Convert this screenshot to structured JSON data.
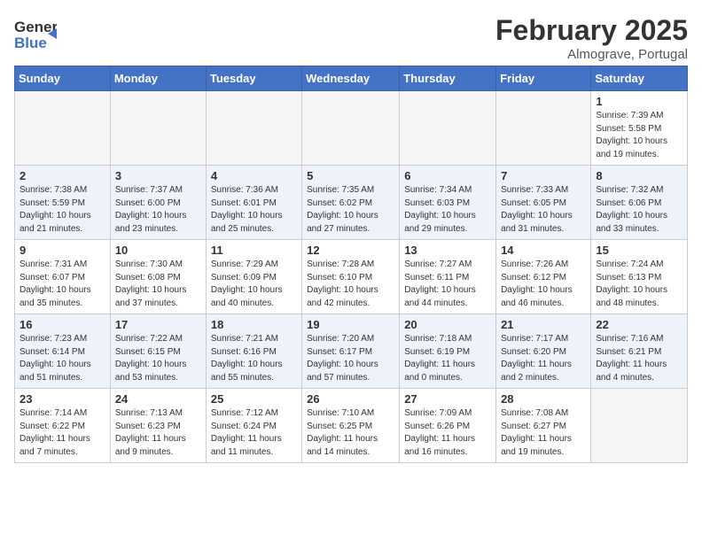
{
  "header": {
    "logo_general": "General",
    "logo_blue": "Blue",
    "title": "February 2025",
    "subtitle": "Almograve, Portugal"
  },
  "weekdays": [
    "Sunday",
    "Monday",
    "Tuesday",
    "Wednesday",
    "Thursday",
    "Friday",
    "Saturday"
  ],
  "weeks": [
    [
      {
        "day": "",
        "info": ""
      },
      {
        "day": "",
        "info": ""
      },
      {
        "day": "",
        "info": ""
      },
      {
        "day": "",
        "info": ""
      },
      {
        "day": "",
        "info": ""
      },
      {
        "day": "",
        "info": ""
      },
      {
        "day": "1",
        "info": "Sunrise: 7:39 AM\nSunset: 5:58 PM\nDaylight: 10 hours and 19 minutes."
      }
    ],
    [
      {
        "day": "2",
        "info": "Sunrise: 7:38 AM\nSunset: 5:59 PM\nDaylight: 10 hours and 21 minutes."
      },
      {
        "day": "3",
        "info": "Sunrise: 7:37 AM\nSunset: 6:00 PM\nDaylight: 10 hours and 23 minutes."
      },
      {
        "day": "4",
        "info": "Sunrise: 7:36 AM\nSunset: 6:01 PM\nDaylight: 10 hours and 25 minutes."
      },
      {
        "day": "5",
        "info": "Sunrise: 7:35 AM\nSunset: 6:02 PM\nDaylight: 10 hours and 27 minutes."
      },
      {
        "day": "6",
        "info": "Sunrise: 7:34 AM\nSunset: 6:03 PM\nDaylight: 10 hours and 29 minutes."
      },
      {
        "day": "7",
        "info": "Sunrise: 7:33 AM\nSunset: 6:05 PM\nDaylight: 10 hours and 31 minutes."
      },
      {
        "day": "8",
        "info": "Sunrise: 7:32 AM\nSunset: 6:06 PM\nDaylight: 10 hours and 33 minutes."
      }
    ],
    [
      {
        "day": "9",
        "info": "Sunrise: 7:31 AM\nSunset: 6:07 PM\nDaylight: 10 hours and 35 minutes."
      },
      {
        "day": "10",
        "info": "Sunrise: 7:30 AM\nSunset: 6:08 PM\nDaylight: 10 hours and 37 minutes."
      },
      {
        "day": "11",
        "info": "Sunrise: 7:29 AM\nSunset: 6:09 PM\nDaylight: 10 hours and 40 minutes."
      },
      {
        "day": "12",
        "info": "Sunrise: 7:28 AM\nSunset: 6:10 PM\nDaylight: 10 hours and 42 minutes."
      },
      {
        "day": "13",
        "info": "Sunrise: 7:27 AM\nSunset: 6:11 PM\nDaylight: 10 hours and 44 minutes."
      },
      {
        "day": "14",
        "info": "Sunrise: 7:26 AM\nSunset: 6:12 PM\nDaylight: 10 hours and 46 minutes."
      },
      {
        "day": "15",
        "info": "Sunrise: 7:24 AM\nSunset: 6:13 PM\nDaylight: 10 hours and 48 minutes."
      }
    ],
    [
      {
        "day": "16",
        "info": "Sunrise: 7:23 AM\nSunset: 6:14 PM\nDaylight: 10 hours and 51 minutes."
      },
      {
        "day": "17",
        "info": "Sunrise: 7:22 AM\nSunset: 6:15 PM\nDaylight: 10 hours and 53 minutes."
      },
      {
        "day": "18",
        "info": "Sunrise: 7:21 AM\nSunset: 6:16 PM\nDaylight: 10 hours and 55 minutes."
      },
      {
        "day": "19",
        "info": "Sunrise: 7:20 AM\nSunset: 6:17 PM\nDaylight: 10 hours and 57 minutes."
      },
      {
        "day": "20",
        "info": "Sunrise: 7:18 AM\nSunset: 6:19 PM\nDaylight: 11 hours and 0 minutes."
      },
      {
        "day": "21",
        "info": "Sunrise: 7:17 AM\nSunset: 6:20 PM\nDaylight: 11 hours and 2 minutes."
      },
      {
        "day": "22",
        "info": "Sunrise: 7:16 AM\nSunset: 6:21 PM\nDaylight: 11 hours and 4 minutes."
      }
    ],
    [
      {
        "day": "23",
        "info": "Sunrise: 7:14 AM\nSunset: 6:22 PM\nDaylight: 11 hours and 7 minutes."
      },
      {
        "day": "24",
        "info": "Sunrise: 7:13 AM\nSunset: 6:23 PM\nDaylight: 11 hours and 9 minutes."
      },
      {
        "day": "25",
        "info": "Sunrise: 7:12 AM\nSunset: 6:24 PM\nDaylight: 11 hours and 11 minutes."
      },
      {
        "day": "26",
        "info": "Sunrise: 7:10 AM\nSunset: 6:25 PM\nDaylight: 11 hours and 14 minutes."
      },
      {
        "day": "27",
        "info": "Sunrise: 7:09 AM\nSunset: 6:26 PM\nDaylight: 11 hours and 16 minutes."
      },
      {
        "day": "28",
        "info": "Sunrise: 7:08 AM\nSunset: 6:27 PM\nDaylight: 11 hours and 19 minutes."
      },
      {
        "day": "",
        "info": ""
      }
    ]
  ]
}
